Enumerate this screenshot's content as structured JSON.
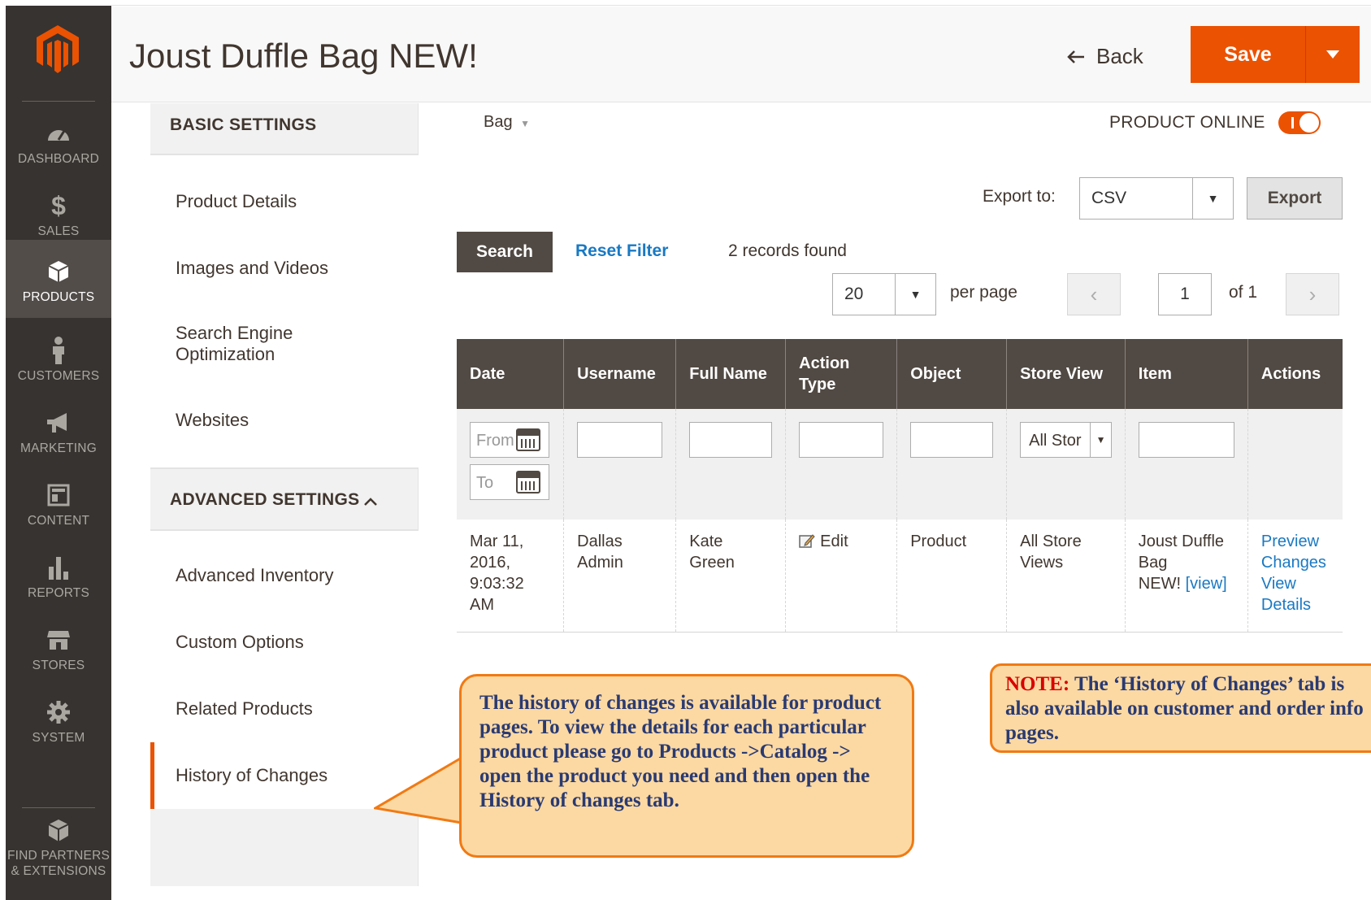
{
  "sidebar": {
    "items": [
      {
        "label": "DASHBOARD",
        "icon": "dashboard-icon"
      },
      {
        "label": "SALES",
        "icon": "dollar-icon"
      },
      {
        "label": "PRODUCTS",
        "icon": "cube-icon"
      },
      {
        "label": "CUSTOMERS",
        "icon": "person-icon"
      },
      {
        "label": "MARKETING",
        "icon": "megaphone-icon"
      },
      {
        "label": "CONTENT",
        "icon": "layout-icon"
      },
      {
        "label": "REPORTS",
        "icon": "bar-chart-icon"
      },
      {
        "label": "STORES",
        "icon": "storefront-icon"
      },
      {
        "label": "SYSTEM",
        "icon": "gear-icon"
      },
      {
        "label": "FIND PARTNERS",
        "label2": "& EXTENSIONS",
        "icon": "boxes-icon"
      }
    ],
    "active_item": "PRODUCTS"
  },
  "header": {
    "title": "Joust Duffle Bag NEW!",
    "back_label": "Back",
    "save_label": "Save"
  },
  "tabs": {
    "basic_title": "BASIC SETTINGS",
    "advanced_title": "ADVANCED SETTINGS",
    "basic_items": [
      "Product Details",
      "Images and Videos",
      "Search Engine",
      "Optimization",
      "Websites"
    ],
    "advanced_items": [
      "Advanced Inventory",
      "Custom Options",
      "Related Products",
      "History of Changes"
    ],
    "active": "History of Changes"
  },
  "main": {
    "attribute_set": "Bag",
    "product_online_label": "PRODUCT ONLINE",
    "product_online": true,
    "export_label": "Export to:",
    "export_value": "CSV",
    "export_button": "Export",
    "search_button": "Search",
    "reset_filter": "Reset Filter",
    "records_found": "2 records found",
    "per_page_value": "20",
    "per_page_label": "per page",
    "page_current": "1",
    "page_of": "of 1"
  },
  "grid": {
    "columns": [
      "Date",
      "Username",
      "Full Name",
      "Action",
      "Type",
      "Object",
      "Store View",
      "Item",
      "Actions"
    ],
    "filters": {
      "date_from_placeholder": "From",
      "date_to_placeholder": "To",
      "store_view_value": "All Stor"
    },
    "rows": [
      {
        "date": [
          "Mar 11,",
          "2016,",
          "9:03:32",
          "AM"
        ],
        "username": [
          "Dallas",
          "Admin"
        ],
        "full_name": [
          "Kate",
          "Green"
        ],
        "action_type": "Edit",
        "object": "Product",
        "store_view": [
          "All Store",
          "Views"
        ],
        "item": [
          "Joust Duffle",
          "Bag",
          "NEW!"
        ],
        "item_link": "[view]",
        "actions": [
          "Preview",
          "Changes",
          "View",
          "Details"
        ]
      }
    ]
  },
  "callouts": {
    "left": "The history of changes is available for product pages. To view the details for each particular product please go to Products ->Catalog -> open the product you need and then open the History of changes tab.",
    "right_key": "NOTE:",
    "right": "The ‘History of Changes’ tab is also available on customer and order info pages."
  },
  "colors": {
    "sidebar_bg": "#373330",
    "accent": "#eb5202",
    "grid_header": "#514943",
    "link": "#1979c3",
    "callout_bg": "#fcd9a3",
    "callout_border": "#f07a14"
  }
}
